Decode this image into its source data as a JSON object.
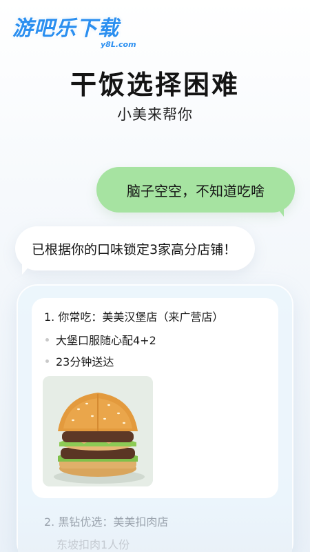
{
  "watermark": {
    "main": "游吧乐下载",
    "sub": "y8L.com"
  },
  "hero": {
    "title": "干饭选择困难",
    "subtitle": "小美来帮你"
  },
  "chat": {
    "user_message": "脑子空空，不知道吃啥",
    "bot_message": "已根据你的口味锁定3家高分店铺！"
  },
  "recommendations": [
    {
      "title": "1. 你常吃：美美汉堡店（来广营店）",
      "details": [
        "大堡口服随心配4+2",
        "23分钟送达"
      ],
      "image": "burger-photo"
    },
    {
      "title": "2. 黑钻优选：美美扣肉店",
      "details": [
        "东坡扣肉1人份"
      ]
    }
  ],
  "colors": {
    "user_bubble": "#a6e3a1",
    "bot_bubble": "#ffffff",
    "watermark": "#2b8ff0"
  }
}
